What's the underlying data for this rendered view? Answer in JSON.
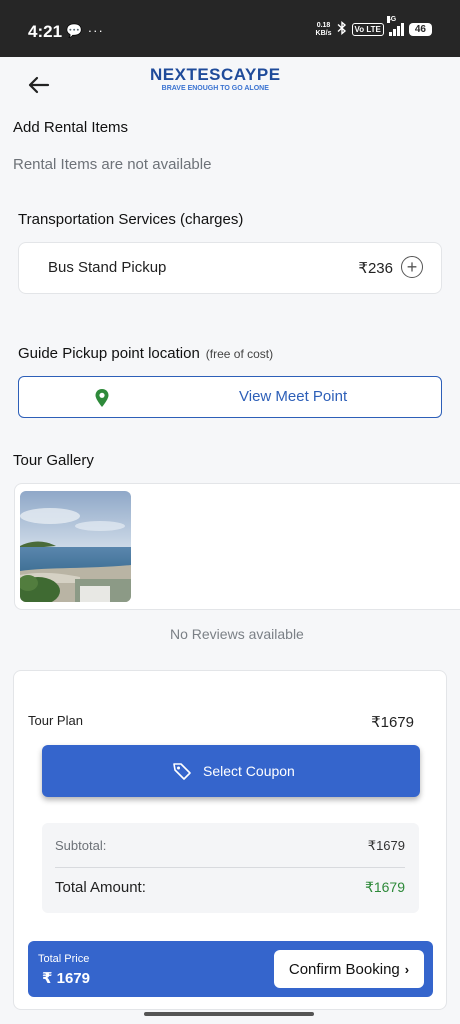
{
  "status_bar": {
    "time": "4:21",
    "left_icons": "💬 ···",
    "net_speed_value": "0.18",
    "net_speed_unit": "KB/s",
    "volte": "Vo LTE",
    "network": "4G",
    "battery": "46"
  },
  "header": {
    "logo_title": "NEXTESCAYPE",
    "logo_subtitle": "BRAVE ENOUGH TO GO ALONE"
  },
  "rental": {
    "title": "Add Rental Items",
    "empty_text": "Rental Items are not available"
  },
  "transport": {
    "title": "Transportation Services (charges)",
    "item_name": "Bus Stand Pickup",
    "item_price": "₹236",
    "add_symbol": "+"
  },
  "guide": {
    "title": "Guide Pickup point location",
    "note": "(free of cost)",
    "button_label": "View Meet Point"
  },
  "gallery": {
    "title": "Tour Gallery",
    "reviews_empty": "No Reviews available"
  },
  "summary": {
    "tour_plan_label": "Tour Plan",
    "tour_plan_price": "₹1679",
    "coupon_label": "Select Coupon",
    "subtotal_label": "Subtotal:",
    "subtotal_value": "₹1679",
    "total_label": "Total Amount:",
    "total_value": "₹1679",
    "total_price_label": "Total Price",
    "total_price_value": "₹ 1679",
    "confirm_label": "Confirm Booking",
    "confirm_chevron": "›"
  },
  "colors": {
    "primary": "#3565cc",
    "brand": "#1f4b9a",
    "success": "#2e8a3a",
    "pin": "#2e8a3a"
  },
  "icons": {
    "back": "arrow-left-icon",
    "pin": "map-pin-icon",
    "coupon": "tag-icon",
    "add": "plus-circle-icon"
  }
}
